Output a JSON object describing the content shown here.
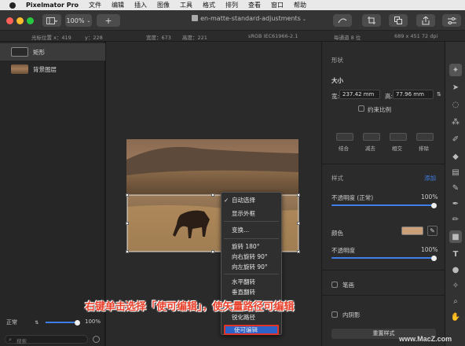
{
  "menubar": {
    "app_name": "Pixelmator Pro",
    "items": [
      "文件",
      "编辑",
      "插入",
      "图像",
      "工具",
      "格式",
      "排列",
      "查看",
      "窗口",
      "帮助"
    ]
  },
  "toolbar": {
    "zoom": "100%",
    "add_label": "+",
    "doc_title": "en-matte-standard-adjustments"
  },
  "infobar": {
    "cursor_x": "光标位置 x：419",
    "cursor_y": "y：228",
    "width": "宽度：673",
    "height": "高度：221",
    "color_profile": "sRGB IEC61966-2.1",
    "bit_depth": "每通道 8 位",
    "image_size": "689 x 451 72 dpi"
  },
  "layers": [
    {
      "name": "矩形"
    },
    {
      "name": "背景图层"
    }
  ],
  "bottom_left": {
    "blend_mode": "正常",
    "opacity": "100%",
    "search_placeholder": "搜索"
  },
  "context_menu": {
    "auto_select": "自动选择",
    "show_frame": "显示外框",
    "transform": "变换...",
    "rotate_180": "旋转 180°",
    "rotate_right": "向右旋转 90°",
    "rotate_left": "向左旋转 90°",
    "flip_h": "水平翻转",
    "flip_v": "垂直翻转",
    "item_hidden": "转",
    "sharpen_path": "锐化路径",
    "make_editable": "使可编辑"
  },
  "right_panel": {
    "section_title": "形状",
    "size_label": "大小",
    "width_label": "宽:",
    "width_value": "237.42 mm",
    "height_label": "高:",
    "height_value": "77.96 mm",
    "constrain": "约束比例",
    "bool_ops": [
      "结合",
      "减去",
      "相交",
      "排除"
    ],
    "style_title": "样式",
    "add_label": "添加",
    "opacity_normal_label": "不透明度 (正常)",
    "opacity_normal_value": "100%",
    "color_label": "颜色",
    "fill_color": "#c9a07a",
    "opacity_label": "不透明度",
    "opacity_value": "100%",
    "stroke_label": "笔画",
    "shadow_label": "内阴影",
    "reset_style": "重置样式"
  },
  "annotation": {
    "text": "右键单击选择「使可编辑」，使矢量路径可编辑",
    "color": "#e8412c"
  },
  "watermark": "www.MacZ.com",
  "colors": {
    "accent": "#3d7ee9",
    "highlight_border": "#e0342a"
  }
}
